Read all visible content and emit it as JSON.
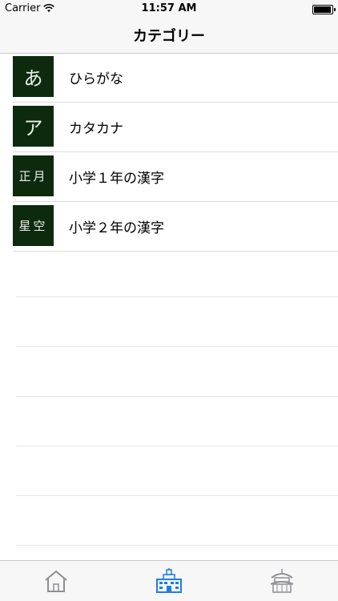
{
  "status_bar": {
    "carrier": "Carrier",
    "time": "11:57 AM",
    "wifi_icon": "wifi-icon",
    "battery_icon": "battery-icon",
    "battery_level": 1.0
  },
  "nav": {
    "title": "カテゴリー"
  },
  "categories": [
    {
      "thumb": "あ",
      "label": "ひらがな"
    },
    {
      "thumb": "ア",
      "label": "カタカナ"
    },
    {
      "thumb": "正月",
      "label": "小学１年の漢字"
    },
    {
      "thumb": "星空",
      "label": "小学２年の漢字"
    }
  ],
  "tab_bar": {
    "items": [
      {
        "icon": "home-icon",
        "color": "#8e8e93",
        "selected": false
      },
      {
        "icon": "school-icon",
        "color": "#1e7de1",
        "selected": true
      },
      {
        "icon": "shrine-icon",
        "color": "#8e8e93",
        "selected": false
      }
    ]
  },
  "colors": {
    "thumb_background": "#0e2a0e",
    "accent": "#1e7de1"
  }
}
